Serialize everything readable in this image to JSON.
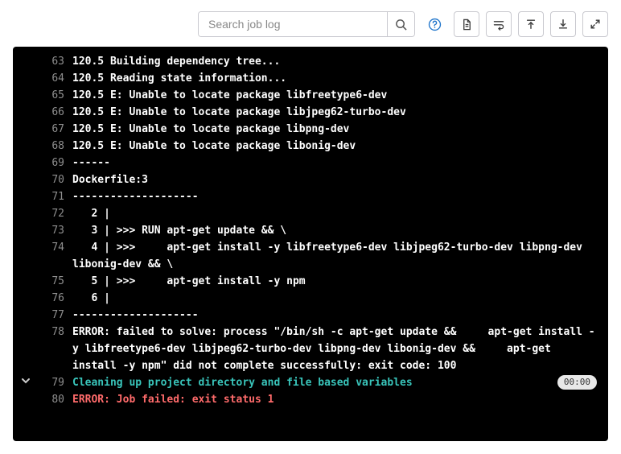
{
  "toolbar": {
    "search_placeholder": "Search job log"
  },
  "log": {
    "timepill": "00:00",
    "timepill_line": 79,
    "lines": [
      {
        "num": 63,
        "text": "120.5 Building dependency tree..."
      },
      {
        "num": 64,
        "text": "120.5 Reading state information..."
      },
      {
        "num": 65,
        "text": "120.5 E: Unable to locate package libfreetype6-dev"
      },
      {
        "num": 66,
        "text": "120.5 E: Unable to locate package libjpeg62-turbo-dev"
      },
      {
        "num": 67,
        "text": "120.5 E: Unable to locate package libpng-dev"
      },
      {
        "num": 68,
        "text": "120.5 E: Unable to locate package libonig-dev"
      },
      {
        "num": 69,
        "text": "------"
      },
      {
        "num": 70,
        "text": "Dockerfile:3"
      },
      {
        "num": 71,
        "text": "--------------------"
      },
      {
        "num": 72,
        "text": "   2 |"
      },
      {
        "num": 73,
        "text": "   3 | >>> RUN apt-get update && \\"
      },
      {
        "num": 74,
        "text": "   4 | >>>     apt-get install -y libfreetype6-dev libjpeg62-turbo-dev libpng-dev libonig-dev && \\"
      },
      {
        "num": 75,
        "text": "   5 | >>>     apt-get install -y npm"
      },
      {
        "num": 76,
        "text": "   6 |"
      },
      {
        "num": 77,
        "text": "--------------------"
      },
      {
        "num": 78,
        "text": "ERROR: failed to solve: process \"/bin/sh -c apt-get update &&     apt-get install -y libfreetype6-dev libjpeg62-turbo-dev libpng-dev libonig-dev &&     apt-get install -y npm\" did not complete successfully: exit code: 100"
      },
      {
        "num": 79,
        "text": "Cleaning up project directory and file based variables",
        "color": "teal",
        "collapsible": true
      },
      {
        "num": 80,
        "text": "ERROR: Job failed: exit status 1",
        "color": "red"
      }
    ]
  }
}
